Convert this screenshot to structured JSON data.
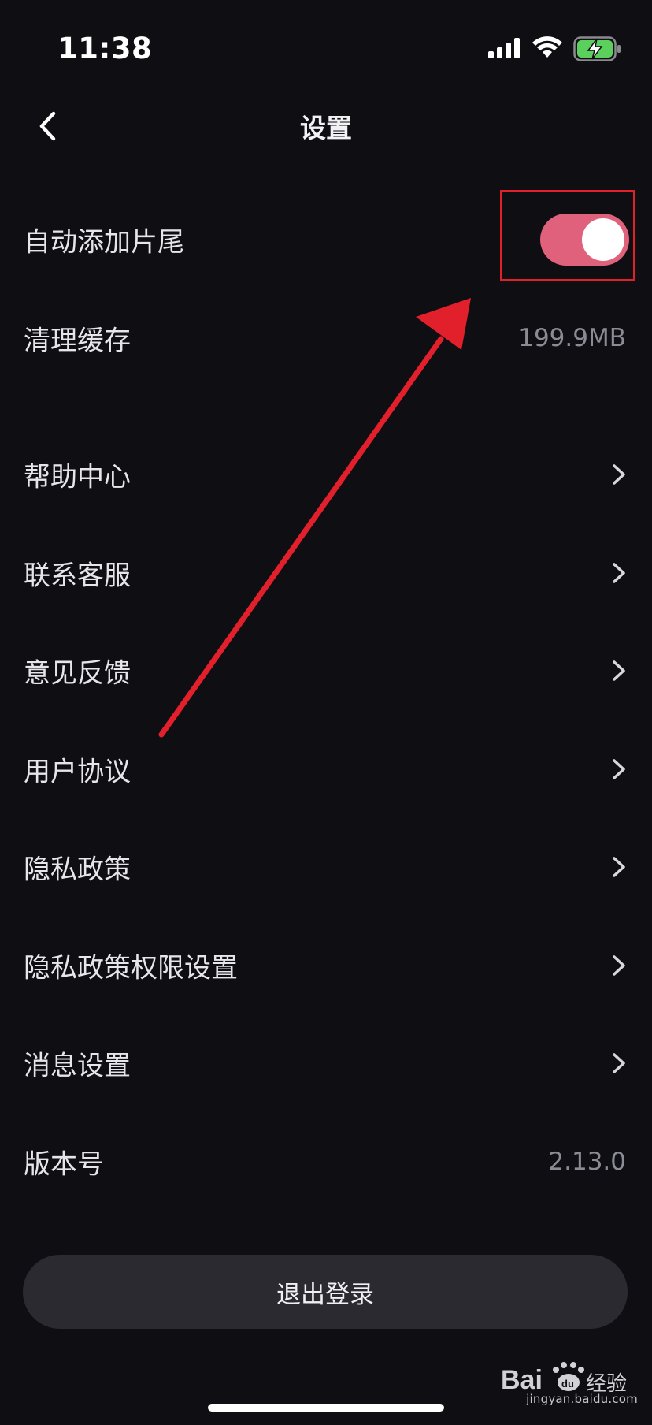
{
  "status_bar": {
    "time": "11:38",
    "icons": [
      "signal-icon",
      "wifi-icon",
      "battery-charging-icon"
    ]
  },
  "header": {
    "title": "设置",
    "back_icon": "chevron-left-icon"
  },
  "settings": {
    "auto_ending": {
      "label": "自动添加片尾",
      "enabled": true,
      "accent": "#e0617b"
    },
    "clear_cache": {
      "label": "清理缓存",
      "value": "199.9MB"
    },
    "help_center": {
      "label": "帮助中心"
    },
    "contact_service": {
      "label": "联系客服"
    },
    "feedback": {
      "label": "意见反馈"
    },
    "user_agreement": {
      "label": "用户协议"
    },
    "privacy_policy": {
      "label": "隐私政策"
    },
    "privacy_permissions": {
      "label": "隐私政策权限设置"
    },
    "message_settings": {
      "label": "消息设置"
    },
    "version": {
      "label": "版本号",
      "value": "2.13.0"
    }
  },
  "logout": {
    "label": "退出登录"
  },
  "watermark": {
    "brand": "Bai du 经验",
    "url": "jingyan.baidu.com"
  },
  "colors": {
    "background": "#0f0e13",
    "toggle_on": "#e0617b",
    "annotation_red": "#e2202b",
    "logout_bg": "#2a2a30"
  }
}
